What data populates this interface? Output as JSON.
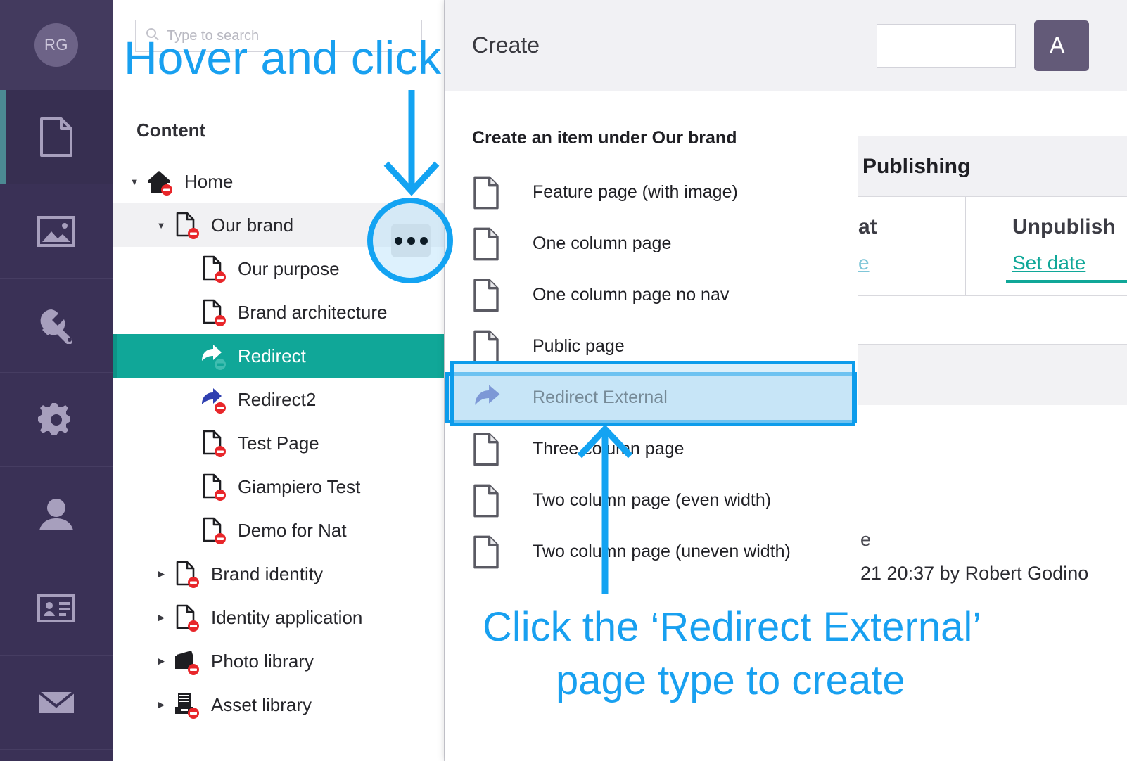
{
  "rail": {
    "avatar_initials": "RG",
    "items": [
      {
        "name": "content",
        "icon": "document-icon",
        "active": true
      },
      {
        "name": "media",
        "icon": "image-icon",
        "active": false
      },
      {
        "name": "settings-tools",
        "icon": "wrench-icon",
        "active": false
      },
      {
        "name": "configuration",
        "icon": "gear-icon",
        "active": false
      },
      {
        "name": "users",
        "icon": "person-icon",
        "active": false
      },
      {
        "name": "members",
        "icon": "contact-card-icon",
        "active": false
      },
      {
        "name": "forms",
        "icon": "envelope-icon",
        "active": false
      }
    ]
  },
  "tree_panel": {
    "search_placeholder": "Type to search",
    "title": "Content",
    "nodes": [
      {
        "label": "Home",
        "icon": "home-icon",
        "depth": 0,
        "caret": "down",
        "badge": "unpublished",
        "state": "normal"
      },
      {
        "label": "Our brand",
        "icon": "document-icon",
        "depth": 1,
        "caret": "down",
        "badge": "unpublished",
        "state": "hovered"
      },
      {
        "label": "Our purpose",
        "icon": "document-icon",
        "depth": 2,
        "caret": "none",
        "badge": "unpublished",
        "state": "normal"
      },
      {
        "label": "Brand architecture",
        "icon": "document-icon",
        "depth": 2,
        "caret": "none",
        "badge": "unpublished",
        "state": "normal"
      },
      {
        "label": "Redirect",
        "icon": "redirect-icon",
        "depth": 2,
        "caret": "none",
        "badge": "unpublished",
        "state": "selected"
      },
      {
        "label": "Redirect2",
        "icon": "redirect-icon",
        "depth": 2,
        "caret": "none",
        "badge": "unpublished",
        "state": "normal"
      },
      {
        "label": "Test Page",
        "icon": "document-icon",
        "depth": 2,
        "caret": "none",
        "badge": "unpublished",
        "state": "normal"
      },
      {
        "label": "Giampiero Test",
        "icon": "document-icon",
        "depth": 2,
        "caret": "none",
        "badge": "unpublished",
        "state": "normal"
      },
      {
        "label": "Demo for Nat",
        "icon": "document-icon",
        "depth": 2,
        "caret": "none",
        "badge": "unpublished",
        "state": "normal"
      },
      {
        "label": "Brand identity",
        "icon": "document-icon",
        "depth": 1,
        "caret": "right",
        "badge": "unpublished",
        "state": "normal"
      },
      {
        "label": "Identity application",
        "icon": "document-icon",
        "depth": 1,
        "caret": "right",
        "badge": "unpublished",
        "state": "normal"
      },
      {
        "label": "Photo library",
        "icon": "photo-library-icon",
        "depth": 1,
        "caret": "right",
        "badge": "unpublished",
        "state": "normal"
      },
      {
        "label": "Asset library",
        "icon": "asset-library-icon",
        "depth": 1,
        "caret": "right",
        "badge": "unpublished",
        "state": "normal"
      }
    ]
  },
  "create_panel": {
    "title": "Create",
    "subtitle": "Create an item under Our brand",
    "items": [
      {
        "label": "Feature page (with image)",
        "icon": "document-icon",
        "highlighted": false
      },
      {
        "label": "One column page",
        "icon": "document-icon",
        "highlighted": false
      },
      {
        "label": "One column page no nav",
        "icon": "document-icon",
        "highlighted": false
      },
      {
        "label": "Public page",
        "icon": "document-icon",
        "highlighted": false
      },
      {
        "label": "Redirect External",
        "icon": "redirect-icon",
        "highlighted": true
      },
      {
        "label": "Three column page",
        "icon": "document-icon",
        "highlighted": false
      },
      {
        "label": "Two column page (even width)",
        "icon": "document-icon",
        "highlighted": false
      },
      {
        "label": "Two column page (uneven width)",
        "icon": "document-icon",
        "highlighted": false
      }
    ]
  },
  "right_pane": {
    "action_button_label": "A",
    "section_title": "Publishing",
    "col_a_title": "at",
    "col_a_link": "e",
    "col_b_title": "Unpublish",
    "col_b_link": "Set date",
    "meta_fragment": "e",
    "meta_line": "21 20:37 by Robert Godino"
  },
  "annotations": {
    "hover_and_click": "Hover and click",
    "click_line1": "Click the ‘Redirect External’",
    "click_line2": "page type to create",
    "accent_color": "#18a0f0",
    "highlight_fill": "#d3e9f8",
    "selected_row_color": "#10a798"
  }
}
